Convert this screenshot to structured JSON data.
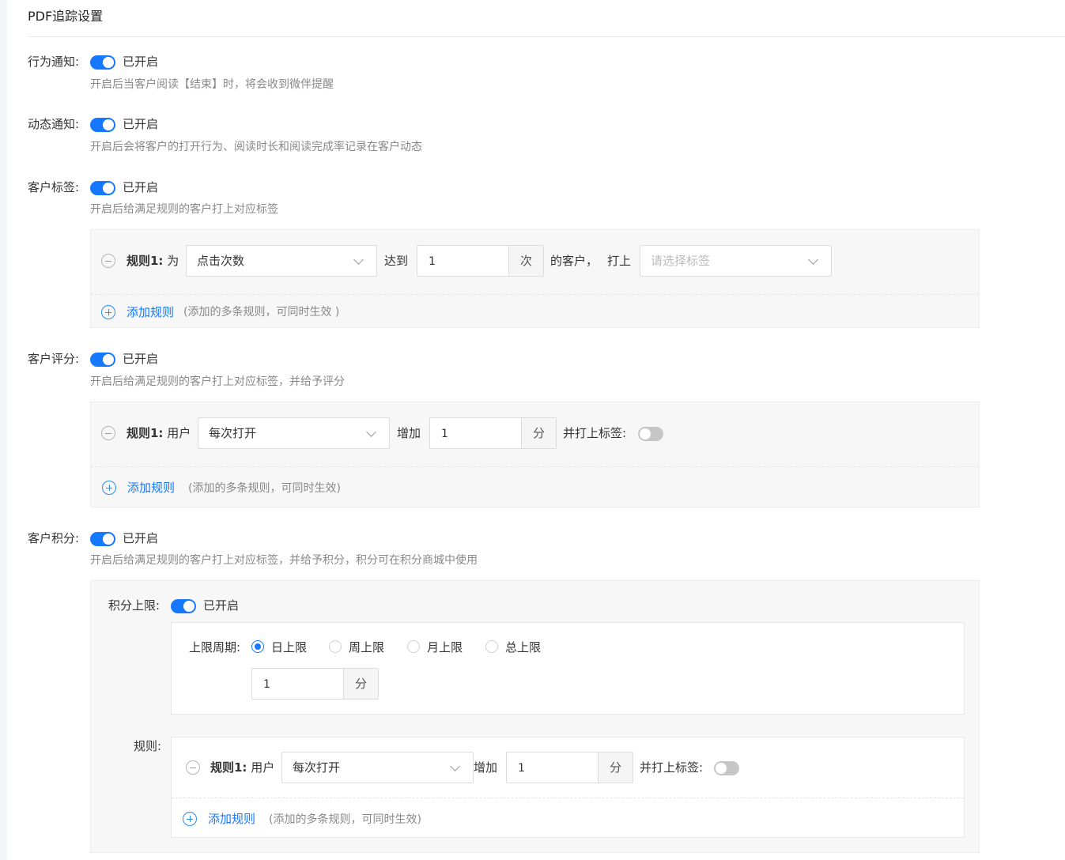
{
  "page_title": "PDF追踪设置",
  "behavior_notify": {
    "label": "行为通知:",
    "status": "已开启",
    "desc": "开启后当客户阅读【结束】时，将会收到微伴提醒"
  },
  "dynamic_notify": {
    "label": "动态通知:",
    "status": "已开启",
    "desc": "开启后会将客户的打开行为、阅读时长和阅读完成率记录在客户动态"
  },
  "customer_tag": {
    "label": "客户标签:",
    "status": "已开启",
    "desc": "开启后给满足规则的客户打上对应标签",
    "rule": {
      "rule_name": "规则1:",
      "prefix": "为",
      "select_value": "点击次数",
      "reach_label": "达到",
      "count_value": "1",
      "count_unit": "次",
      "suffix": "的客户，",
      "tag_label": "打上",
      "tag_placeholder": "请选择标签"
    },
    "add_rule": {
      "label": "添加规则",
      "hint": "(添加的多条规则，可同时生效 )"
    }
  },
  "customer_score": {
    "label": "客户评分:",
    "status": "已开启",
    "desc": "开启后给满足规则的客户打上对应标签，并给予评分",
    "rule": {
      "rule_name": "规则1:",
      "prefix": "用户",
      "select_value": "每次打开",
      "add_label": "增加",
      "score_value": "1",
      "score_unit": "分",
      "tag_label": "并打上标签:",
      "tag_switch": "off"
    },
    "add_rule": {
      "label": "添加规则",
      "hint": "(添加的多条规则，可同时生效)"
    }
  },
  "customer_points": {
    "label": "客户积分:",
    "status": "已开启",
    "desc": "开启后给满足规则的客户打上对应标签，并给予积分，积分可在积分商城中使用",
    "limit": {
      "label": "积分上限:",
      "status": "已开启",
      "period_label": "上限周期:",
      "periods": [
        {
          "label": "日上限",
          "selected": true
        },
        {
          "label": "周上限",
          "selected": false
        },
        {
          "label": "月上限",
          "selected": false
        },
        {
          "label": "总上限",
          "selected": false
        }
      ],
      "value": "1",
      "unit": "分"
    },
    "rules_label": "规则:",
    "rule": {
      "rule_name": "规则1:",
      "prefix": "用户",
      "select_value": "每次打开",
      "add_label": "增加",
      "score_value": "1",
      "score_unit": "分",
      "tag_label": "并打上标签:",
      "tag_switch": "off"
    },
    "add_rule": {
      "label": "添加规则",
      "hint": "(添加的多条规则，可同时生效)"
    }
  },
  "colors": {
    "primary": "#1677ff",
    "switch_off": "#c6c6c6",
    "panel_bg": "#f7f7f7"
  }
}
